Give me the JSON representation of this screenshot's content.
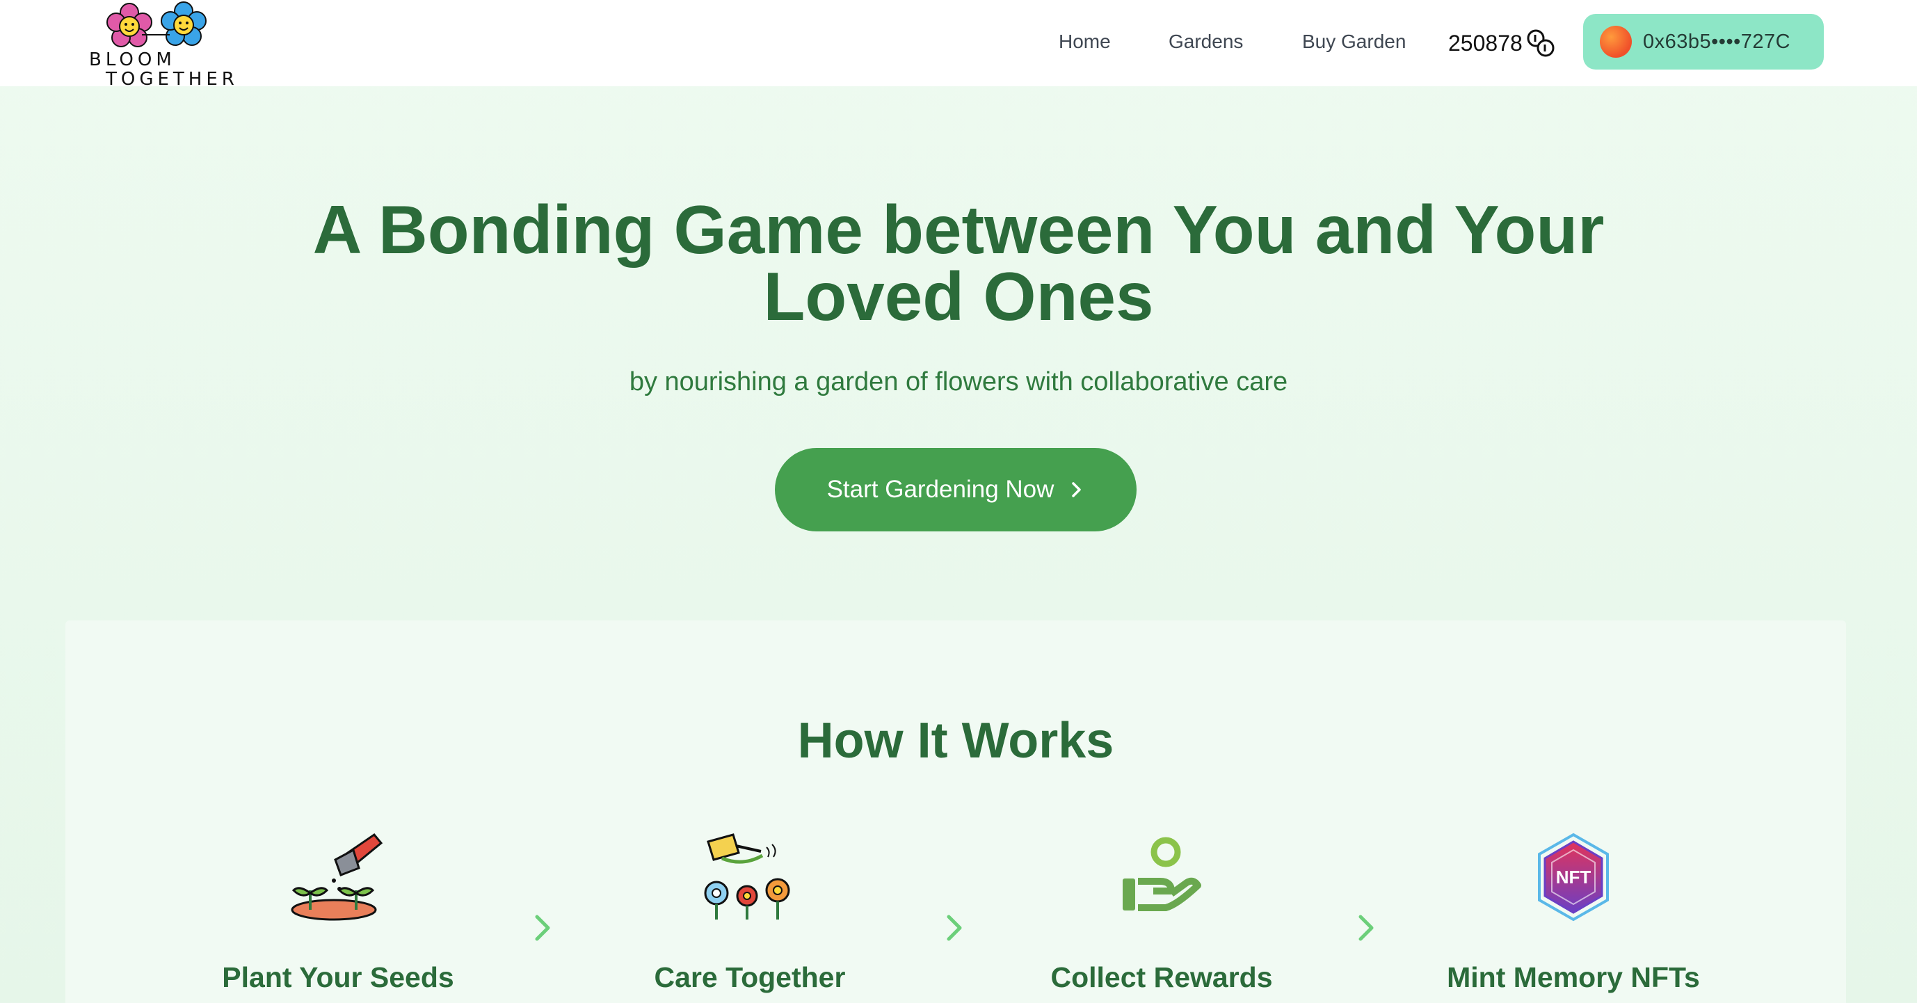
{
  "brand": {
    "line1": "BLOOM",
    "line2": "TOGETHER"
  },
  "nav": {
    "home": "Home",
    "gardens": "Gardens",
    "buy": "Buy Garden"
  },
  "balance": {
    "value": "250878",
    "icon": "coins-icon"
  },
  "wallet": {
    "address": "0x63b5••••727C"
  },
  "hero": {
    "title": "A Bonding Game between You and Your Loved Ones",
    "subtitle": "by nourishing a garden of flowers with collaborative care",
    "cta": "Start Gardening Now"
  },
  "how": {
    "title": "How It Works",
    "steps": [
      {
        "label": "Plant Your Seeds",
        "icon": "plant-seeds-icon"
      },
      {
        "label": "Care Together",
        "icon": "watering-flowers-icon"
      },
      {
        "label": "Collect Rewards",
        "icon": "hand-coin-icon"
      },
      {
        "label": "Mint Memory NFTs",
        "icon": "nft-badge-icon"
      }
    ]
  },
  "colors": {
    "primary": "#45a04f",
    "heading": "#2b6b3a",
    "wallet": "#8de6c6"
  }
}
